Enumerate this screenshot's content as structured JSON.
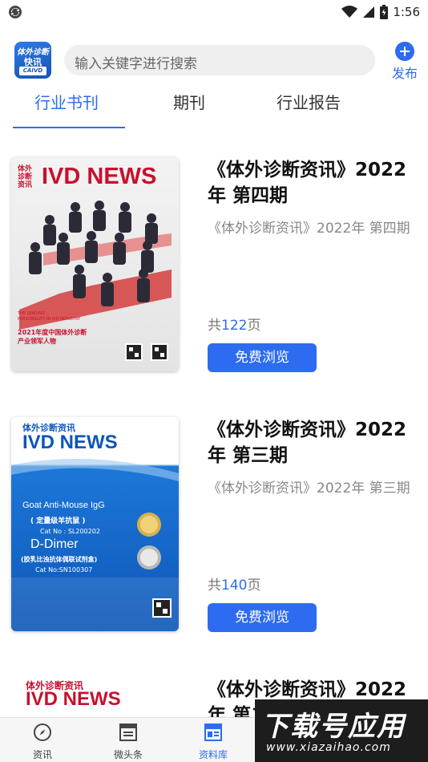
{
  "status_bar": {
    "time": "1:56"
  },
  "header": {
    "logo": {
      "line1": "体外诊断",
      "line2": "快讯",
      "line3": "CAIVD"
    },
    "search_placeholder": "输入关键字进行搜索",
    "publish_label": "发布"
  },
  "tabs": [
    {
      "label": "行业书刊",
      "active": true
    },
    {
      "label": "期刊",
      "active": false
    },
    {
      "label": "行业报告",
      "active": false
    }
  ],
  "items": [
    {
      "title": "《体外诊断资讯》2022年 第四期",
      "desc": "《体外诊断资讯》2022年 第四期",
      "pages_prefix": "共",
      "pages": "122",
      "pages_suffix": "页",
      "button": "免费浏览",
      "cover": {
        "cn_small": "体外\n诊断\n资讯",
        "brand": "IVD NEWS",
        "en_line": "THE LEADING\nPERSONALITY IN IVD INDUSTRY",
        "cn_caption": "2021年度中国体外诊断\n产业领军人物"
      }
    },
    {
      "title": "《体外诊断资讯》2022年 第三期",
      "desc": "《体外诊断资讯》2022年 第三期",
      "pages_prefix": "共",
      "pages": "140",
      "pages_suffix": "页",
      "button": "免费浏览",
      "cover": {
        "cn_small": "体外诊断资讯",
        "brand": "IVD NEWS",
        "line1": "Goat Anti-Mouse IgG",
        "line2": "( 定量级羊抗鼠 )",
        "line3": "Cat No : SL200202",
        "line4": "D-Dimer",
        "line5": "(胶乳比浊抗体偶联试剂盒)",
        "line6": "Cat No:SN100307"
      }
    },
    {
      "title": "《体外诊断资讯》2022年 第二期",
      "cover": {
        "cn_small": "体外诊断资讯",
        "brand": "IVD NEWS"
      }
    }
  ],
  "bottom_nav": [
    {
      "label": "资讯",
      "icon": "compass-icon",
      "active": false
    },
    {
      "label": "微头条",
      "icon": "headline-icon",
      "active": false
    },
    {
      "label": "资料库",
      "icon": "news-library-icon",
      "active": true
    }
  ],
  "watermark": {
    "text": "下载号应用",
    "url": "www.xiazaihao.com"
  },
  "colors": {
    "accent": "#2d6cf0",
    "ivd_red": "#c8102e"
  }
}
